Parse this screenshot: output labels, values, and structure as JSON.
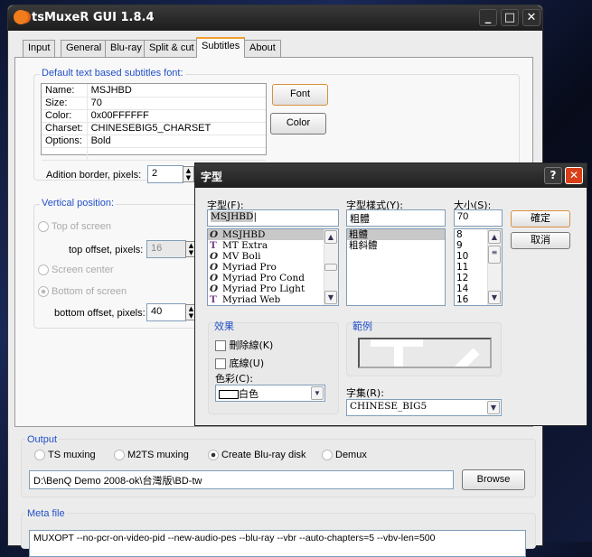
{
  "window": {
    "title": "tsMuxeR GUI 1.8.4",
    "minimize": "_",
    "maximize": "□",
    "close": "✕"
  },
  "tabs": [
    "Input",
    "General",
    "Blu-ray",
    "Split & cut",
    "Subtitles",
    "About"
  ],
  "font_group": {
    "label": "Default text based subtitles font:",
    "rows": [
      [
        "Name:",
        "MSJHBD"
      ],
      [
        "Size:",
        "70"
      ],
      [
        "Color:",
        "0x00FFFFFF"
      ],
      [
        "Charset:",
        "CHINESEBIG5_CHARSET"
      ],
      [
        "Options:",
        "Bold"
      ]
    ],
    "font_button": "Font",
    "color_button": "Color",
    "border_label": "Adition border, pixels:",
    "border_value": "2"
  },
  "vertical": {
    "label": "Vertical position:",
    "top": "Top of screen",
    "top_offset_label": "top offset, pixels:",
    "top_offset": "16",
    "center": "Screen center",
    "bottom": "Bottom of screen",
    "bottom_offset_label": "bottom offset, pixels:",
    "bottom_offset": "40"
  },
  "output": {
    "label": "Output",
    "options": [
      "TS muxing",
      "M2TS muxing",
      "Create Blu-ray disk",
      "Demux"
    ],
    "path": "D:\\BenQ Demo 2008-ok\\台灣版\\BD-tw",
    "browse": "Browse"
  },
  "meta": {
    "label": "Meta file",
    "text": "MUXOPT --no-pcr-on-video-pid --new-audio-pes --blu-ray --vbr  --auto-chapters=5 --vbv-len=500"
  },
  "font_dialog": {
    "title": "字型",
    "help": "?",
    "close": "✕",
    "font_label": "字型(F):",
    "font_value": "MSJHBD",
    "fonts": [
      {
        "name": "MSJHBD",
        "icon": "O"
      },
      {
        "name": "MT Extra",
        "icon": "T"
      },
      {
        "name": "MV Boli",
        "icon": "O"
      },
      {
        "name": "Myriad Pro",
        "icon": "O"
      },
      {
        "name": "Myriad Pro Cond",
        "icon": "O"
      },
      {
        "name": "Myriad Pro Light",
        "icon": "O"
      },
      {
        "name": "Myriad Web",
        "icon": "T"
      }
    ],
    "style_label": "字型樣式(Y):",
    "style_value": "粗體",
    "styles": [
      "粗體",
      "粗斜體"
    ],
    "size_label": "大小(S):",
    "size_value": "70",
    "sizes": [
      "8",
      "9",
      "10",
      "11",
      "12",
      "14",
      "16"
    ],
    "ok": "確定",
    "cancel": "取消",
    "effects_label": "效果",
    "strike": "刪除線(K)",
    "underline": "底線(U)",
    "color_label": "色彩(C):",
    "color_value": "白色",
    "sample_label": "範例",
    "charset_label": "字集(R):",
    "charset_value": "CHINESE_BIG5"
  }
}
